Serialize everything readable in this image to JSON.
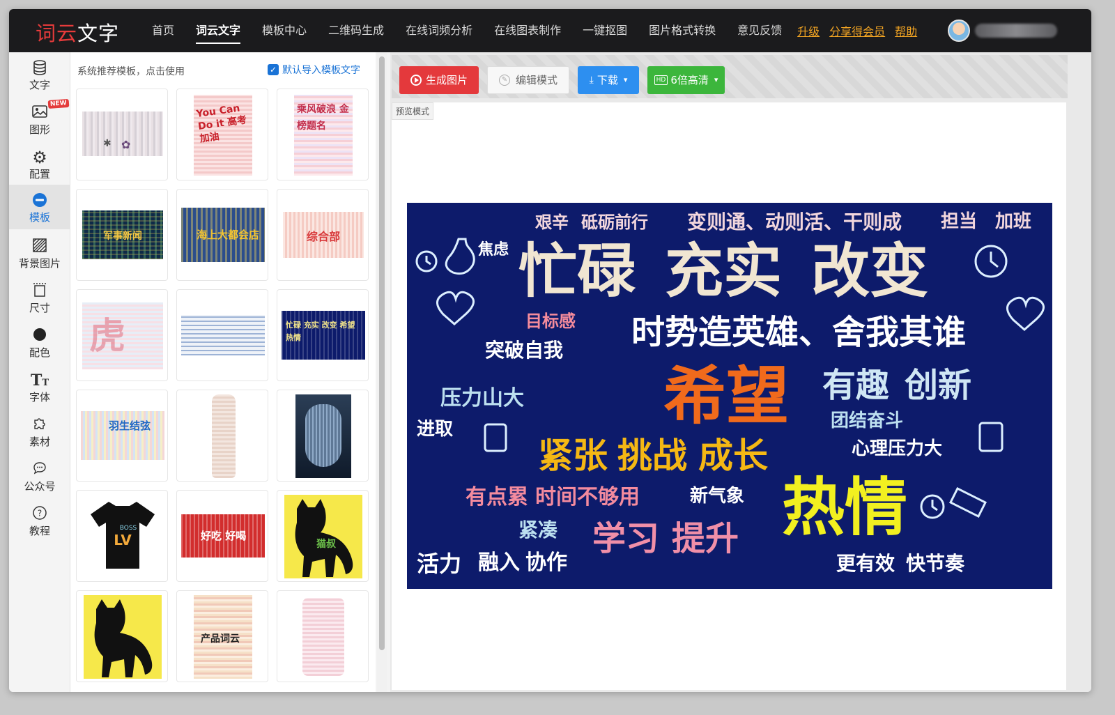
{
  "header": {
    "logo_part1": "词云",
    "logo_part2": "文字",
    "nav": [
      "首页",
      "词云文字",
      "模板中心",
      "二维码生成",
      "在线词频分析",
      "在线图表制作",
      "一键抠图",
      "图片格式转换",
      "意见反馈"
    ],
    "active_nav": "词云文字",
    "links": [
      "升级",
      "分享得会员",
      "帮助"
    ]
  },
  "sidebar": {
    "items": [
      {
        "label": "文字",
        "icon": "database-icon"
      },
      {
        "label": "图形",
        "icon": "image-icon",
        "badge": "NEW"
      },
      {
        "label": "配置",
        "icon": "gear-icon"
      },
      {
        "label": "模板",
        "icon": "template-icon",
        "active": true
      },
      {
        "label": "背景图片",
        "icon": "background-pattern-icon"
      },
      {
        "label": "尺寸",
        "icon": "size-icon"
      },
      {
        "label": "配色",
        "icon": "color-dot-icon"
      },
      {
        "label": "字体",
        "icon": "font-icon"
      },
      {
        "label": "素材",
        "icon": "puzzle-icon"
      },
      {
        "label": "公众号",
        "icon": "chat-bubble-icon"
      },
      {
        "label": "教程",
        "icon": "help-circle-icon"
      }
    ]
  },
  "template_panel": {
    "hint": "系统推荐模板，点击使用",
    "checkbox_label": "默认导入模板文字",
    "checkbox_checked": true,
    "thumb_texts": {
      "t2": "You Can Do it 高考加油",
      "t3": "乘风破浪 金榜题名",
      "t4": "军事新闻",
      "t5": "海上大都会店",
      "t6": "综合部",
      "t9": "忙碌 充实 改变 希望 热情",
      "t10": "羽生结弦",
      "t14": "LV BOSS",
      "t15": "好吃 好喝",
      "t16": "猫叔",
      "t18": "产品词云"
    }
  },
  "toolbar": {
    "generate": "生成图片",
    "edit": "编辑模式",
    "download": "下载",
    "hd": "6倍高清"
  },
  "canvas": {
    "mode_label": "预览模式"
  },
  "wordcloud": {
    "background": "#0d1b6b",
    "big": [
      "忙碌",
      "充实",
      "改变",
      "希望",
      "热情",
      "时势造英雄、舍我其谁",
      "有趣",
      "创新",
      "紧张",
      "挑战",
      "成长",
      "学习",
      "提升",
      "有点累",
      "时间不够用",
      "变则通、动则活、干则成",
      "砥砺前行",
      "艰辛",
      "担当",
      "加班",
      "焦虑",
      "目标感",
      "突破自我",
      "压力山大",
      "团结奋斗",
      "心理压力大",
      "新气象",
      "进取",
      "活力",
      "融入",
      "协作",
      "更有效",
      "快节奏",
      "紧凑"
    ]
  }
}
